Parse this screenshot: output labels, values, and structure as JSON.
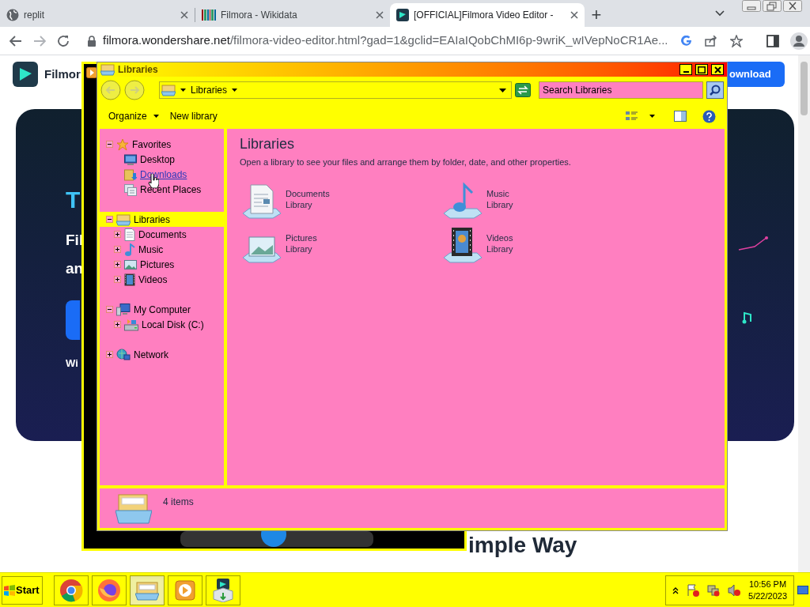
{
  "browser": {
    "tabs": [
      {
        "title": "replit",
        "kind": "globe",
        "selected": false
      },
      {
        "title": "Filmora - Wikidata",
        "kind": "wikidata",
        "selected": false
      },
      {
        "title": "[OFFICIAL]Filmora Video Editor -",
        "kind": "filmora",
        "selected": true
      }
    ],
    "new_tab": "+",
    "url_host": "filmora.wondershare.net",
    "url_path": "/filmora-video-editor.html?gad=1&gclid=EAIaIQobChMI6p-9wriK_wIVepNoCR1Ae..."
  },
  "page": {
    "logo_text": "Filmor",
    "download_button": "ownload",
    "hero_texts": [
      "T",
      "Fil",
      "an",
      "Wi"
    ],
    "heading": "imple Way"
  },
  "explorer": {
    "title": "Libraries",
    "address": "Libraries",
    "search_placeholder": "Search Libraries",
    "toolbar": [
      "Organize",
      "New library"
    ],
    "tree": [
      {
        "label": "Favorites",
        "kind": "star",
        "expanded": true,
        "selected": false,
        "hovered": false,
        "children": [
          {
            "label": "Desktop",
            "kind": "desktop",
            "selected": false,
            "hovered": false
          },
          {
            "label": "Downloads",
            "kind": "downloads",
            "selected": false,
            "hovered": true
          },
          {
            "label": "Recent Places",
            "kind": "recent",
            "selected": false,
            "hovered": false
          }
        ]
      },
      {
        "label": "Libraries",
        "kind": "library",
        "expanded": true,
        "selected": true,
        "hovered": false,
        "children": [
          {
            "label": "Documents",
            "kind": "documents",
            "expanded": false,
            "selected": false,
            "hovered": false
          },
          {
            "label": "Music",
            "kind": "music",
            "expanded": false,
            "selected": false,
            "hovered": false
          },
          {
            "label": "Pictures",
            "kind": "pictures",
            "expanded": false,
            "selected": false,
            "hovered": false
          },
          {
            "label": "Videos",
            "kind": "videos",
            "expanded": false,
            "selected": false,
            "hovered": false
          }
        ]
      },
      {
        "label": "My Computer",
        "kind": "computer",
        "expanded": true,
        "selected": false,
        "hovered": false,
        "children": [
          {
            "label": "Local Disk (C:)",
            "kind": "disk",
            "expanded": false,
            "selected": false,
            "hovered": false
          }
        ]
      },
      {
        "label": "Network",
        "kind": "network",
        "expanded": false,
        "selected": false,
        "hovered": false
      }
    ],
    "heading": "Libraries",
    "description": "Open a library to see your files and arrange them by folder, date, and other properties.",
    "items": [
      {
        "name": "Documents",
        "type": "Library",
        "kind": "documents"
      },
      {
        "name": "Music",
        "type": "Library",
        "kind": "music"
      },
      {
        "name": "Pictures",
        "type": "Library",
        "kind": "pictures"
      },
      {
        "name": "Videos",
        "type": "Library",
        "kind": "videos"
      }
    ],
    "status": "4 items"
  },
  "taskbar": {
    "start": "Start",
    "apps": [
      {
        "kind": "chrome",
        "selected": false
      },
      {
        "kind": "firefox",
        "selected": false
      },
      {
        "kind": "explorer",
        "selected": true
      },
      {
        "kind": "player",
        "selected": false
      },
      {
        "kind": "installer",
        "selected": false
      }
    ],
    "time": "10:56 PM",
    "date": "5/22/2023"
  }
}
